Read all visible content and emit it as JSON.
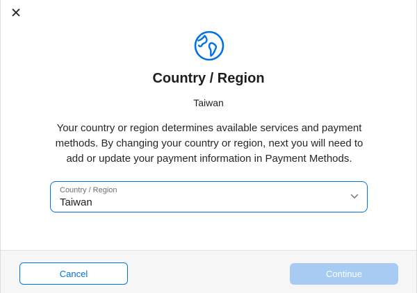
{
  "dialog": {
    "title": "Country / Region",
    "current_region": "Taiwan",
    "description": "Your country or region determines available services and payment methods. By changing your country or region, next you will need to add or update your payment information in Payment Methods.",
    "icons": {
      "close": "close-icon",
      "header": "globe-icon",
      "select": "chevron-down-icon"
    }
  },
  "region_select": {
    "label": "Country / Region",
    "value": "Taiwan"
  },
  "footer": {
    "cancel_label": "Cancel",
    "continue_label": "Continue",
    "continue_enabled": false
  },
  "colors": {
    "accent": "#0071e3",
    "disabled": "#a8cbf3",
    "text_primary": "#1d1d1f",
    "text_secondary": "#6e6e73",
    "divider": "#e3e3e3",
    "footer_bg": "#f6f6f6"
  }
}
